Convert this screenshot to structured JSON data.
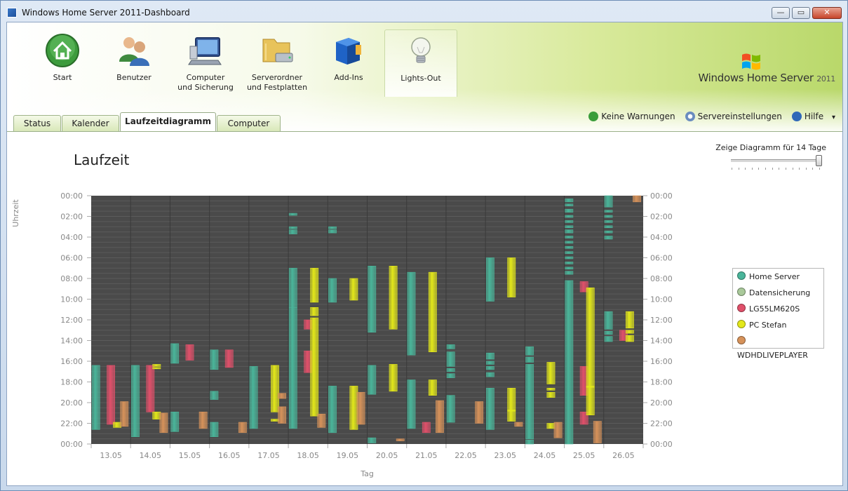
{
  "window": {
    "title": "Windows Home Server 2011-Dashboard",
    "minimize": "—",
    "maximize": "▭",
    "close": "✕"
  },
  "nav": [
    {
      "id": "start",
      "label": "Start",
      "icon": "home-icon"
    },
    {
      "id": "benutzer",
      "label": "Benutzer",
      "icon": "users-icon"
    },
    {
      "id": "computer",
      "label": "Computer\nund Sicherung",
      "icon": "computer-icon"
    },
    {
      "id": "serverordner",
      "label": "Serverordner\nund Festplatten",
      "icon": "folder-drive-icon"
    },
    {
      "id": "addins",
      "label": "Add-Ins",
      "icon": "addin-box-icon"
    },
    {
      "id": "lightsout",
      "label": "Lights-Out",
      "icon": "lightbulb-icon",
      "active": true
    }
  ],
  "brand": {
    "name": "Windows Home Server",
    "year": "2011"
  },
  "tabs": [
    {
      "label": "Status"
    },
    {
      "label": "Kalender"
    },
    {
      "label": "Laufzeitdiagramm",
      "active": true
    },
    {
      "label": "Computer"
    }
  ],
  "status": {
    "warnings": "Keine Warnungen",
    "settings": "Servereinstellungen",
    "help": "Hilfe",
    "help_arrow": "▾"
  },
  "page": {
    "title": "Laufzeit"
  },
  "slider": {
    "label": "Zeige Diagramm für 14 Tage",
    "value": 14,
    "min": 1,
    "max": 14
  },
  "colors": {
    "home_server": "#4ab59a",
    "datensicherung": "#a9c99a",
    "lg": "#e0506a",
    "pc_stefan": "#e3e81a",
    "wdhd": "#d6925a",
    "plot_bg": "#4a4a4a"
  },
  "chart_data": {
    "type": "bar",
    "xlabel": "Tag",
    "ylabel": "Uhrzeit",
    "categories": [
      "13.05",
      "14.05",
      "15.05",
      "16.05",
      "17.05",
      "18.05",
      "19.05",
      "20.05",
      "21.05",
      "22.05",
      "23.05",
      "24.05",
      "25.05",
      "26.05"
    ],
    "y_ticks": [
      "00:00",
      "02:00",
      "04:00",
      "06:00",
      "08:00",
      "10:00",
      "12:00",
      "14:00",
      "16:00",
      "18:00",
      "20:00",
      "22:00",
      "00:00"
    ],
    "ylim": [
      0,
      24
    ],
    "legend": [
      {
        "name": "Home Server",
        "color": "#4ab59a"
      },
      {
        "name": "Datensicherung",
        "color": "#a9c99a"
      },
      {
        "name": "LG55LM620S",
        "color": "#e0506a"
      },
      {
        "name": "PC Stefan",
        "color": "#e3e81a"
      },
      {
        "name": "WDHDLIVEPLAYER",
        "color": "#d6925a"
      }
    ],
    "series": [
      {
        "name": "Home Server",
        "segments": [
          [
            0,
            16.4,
            22.6
          ],
          [
            1,
            16.4,
            23.3
          ],
          [
            2,
            14.3,
            16.2
          ],
          [
            2,
            20.9,
            22.8
          ],
          [
            3,
            14.9,
            16.8
          ],
          [
            3,
            18.9,
            19.7
          ],
          [
            3,
            21.9,
            23.3
          ],
          [
            4,
            16.5,
            22.5
          ],
          [
            5,
            1.7,
            1.9
          ],
          [
            5,
            3.0,
            3.2
          ],
          [
            5,
            3.3,
            3.7
          ],
          [
            5,
            7.0,
            10.8
          ],
          [
            5,
            10.8,
            22.5
          ],
          [
            6,
            3.0,
            3.2
          ],
          [
            6,
            3.3,
            3.6
          ],
          [
            6,
            8.0,
            10.3
          ],
          [
            6,
            18.4,
            22.9
          ],
          [
            7,
            6.8,
            13.2
          ],
          [
            7,
            16.4,
            19.2
          ],
          [
            7,
            23.4,
            23.9
          ],
          [
            8,
            7.4,
            15.4
          ],
          [
            8,
            17.8,
            22.5
          ],
          [
            9,
            14.4,
            14.8
          ],
          [
            9,
            15.1,
            16.5
          ],
          [
            9,
            16.7,
            17.0
          ],
          [
            9,
            17.2,
            17.6
          ],
          [
            9,
            19.3,
            21.9
          ],
          [
            10,
            6.0,
            10.2
          ],
          [
            10,
            15.2,
            15.8
          ],
          [
            10,
            16.0,
            16.3
          ],
          [
            10,
            16.5,
            16.8
          ],
          [
            10,
            17.1,
            17.5
          ],
          [
            10,
            18.6,
            22.6
          ],
          [
            11,
            14.6,
            15.4
          ],
          [
            11,
            15.6,
            16.1
          ],
          [
            11,
            16.3,
            23.5
          ],
          [
            11,
            23.6,
            24.0
          ],
          [
            12,
            0.3,
            0.6
          ],
          [
            12,
            0.8,
            1.0
          ],
          [
            12,
            1.3,
            1.6
          ],
          [
            12,
            1.9,
            2.1
          ],
          [
            12,
            2.4,
            2.6
          ],
          [
            12,
            2.9,
            3.1
          ],
          [
            12,
            3.3,
            3.6
          ],
          [
            12,
            3.9,
            4.1
          ],
          [
            12,
            4.4,
            4.6
          ],
          [
            12,
            4.9,
            5.1
          ],
          [
            12,
            5.4,
            5.6
          ],
          [
            12,
            5.9,
            6.1
          ],
          [
            12,
            6.4,
            6.6
          ],
          [
            12,
            6.9,
            7.1
          ],
          [
            12,
            7.3,
            7.6
          ],
          [
            12,
            8.2,
            24.0
          ],
          [
            13,
            0.0,
            1.1
          ],
          [
            13,
            1.4,
            1.6
          ],
          [
            13,
            1.9,
            2.1
          ],
          [
            13,
            2.4,
            2.6
          ],
          [
            13,
            2.9,
            3.1
          ],
          [
            13,
            3.4,
            3.6
          ],
          [
            13,
            3.9,
            4.2
          ],
          [
            13,
            11.2,
            12.9
          ],
          [
            13,
            13.1,
            13.4
          ],
          [
            13,
            13.6,
            14.1
          ]
        ]
      },
      {
        "name": "Datensicherung",
        "segments": []
      },
      {
        "name": "LG55LM620S",
        "segments": [
          [
            0,
            16.4,
            22.1
          ],
          [
            1,
            16.4,
            20.9
          ],
          [
            2,
            14.4,
            15.9
          ],
          [
            3,
            14.9,
            16.6
          ],
          [
            5,
            12.0,
            12.9
          ],
          [
            5,
            15.0,
            17.1
          ],
          [
            8,
            21.9,
            22.9
          ],
          [
            12,
            8.3,
            9.3
          ],
          [
            12,
            16.5,
            19.3
          ],
          [
            12,
            20.9,
            22.1
          ],
          [
            13,
            13.0,
            14.0
          ]
        ]
      },
      {
        "name": "PC Stefan",
        "segments": [
          [
            0,
            21.9,
            22.4
          ],
          [
            1,
            16.3,
            16.5
          ],
          [
            1,
            16.6,
            16.7
          ],
          [
            1,
            20.9,
            21.6
          ],
          [
            4,
            16.4,
            20.9
          ],
          [
            4,
            21.6,
            21.8
          ],
          [
            5,
            7.0,
            10.3
          ],
          [
            5,
            10.8,
            11.6
          ],
          [
            5,
            11.8,
            21.3
          ],
          [
            6,
            8.0,
            10.1
          ],
          [
            6,
            18.4,
            22.6
          ],
          [
            7,
            6.8,
            12.9
          ],
          [
            7,
            16.3,
            18.9
          ],
          [
            8,
            7.4,
            15.1
          ],
          [
            8,
            17.8,
            19.3
          ],
          [
            10,
            6.0,
            9.8
          ],
          [
            10,
            18.6,
            21.8
          ],
          [
            10,
            20.7,
            20.8
          ],
          [
            11,
            16.1,
            18.2
          ],
          [
            11,
            18.6,
            18.8
          ],
          [
            11,
            19.0,
            19.5
          ],
          [
            11,
            22.0,
            22.5
          ],
          [
            12,
            8.9,
            21.2
          ],
          [
            12,
            18.4,
            18.5
          ],
          [
            13,
            11.2,
            12.8
          ],
          [
            13,
            13.0,
            13.3
          ],
          [
            13,
            13.5,
            14.1
          ]
        ]
      },
      {
        "name": "WDHDLIVEPLAYER",
        "segments": [
          [
            0,
            19.9,
            22.3
          ],
          [
            1,
            21.0,
            22.9
          ],
          [
            2,
            20.9,
            22.5
          ],
          [
            3,
            21.9,
            22.9
          ],
          [
            4,
            19.1,
            19.6
          ],
          [
            4,
            20.4,
            22.0
          ],
          [
            5,
            21.1,
            22.4
          ],
          [
            6,
            19.0,
            22.1
          ],
          [
            7,
            23.5,
            23.7
          ],
          [
            8,
            19.8,
            22.9
          ],
          [
            9,
            19.9,
            22.0
          ],
          [
            10,
            21.9,
            22.3
          ],
          [
            11,
            21.9,
            23.4
          ],
          [
            12,
            21.8,
            23.9
          ],
          [
            13,
            0.0,
            0.6
          ]
        ]
      }
    ]
  }
}
